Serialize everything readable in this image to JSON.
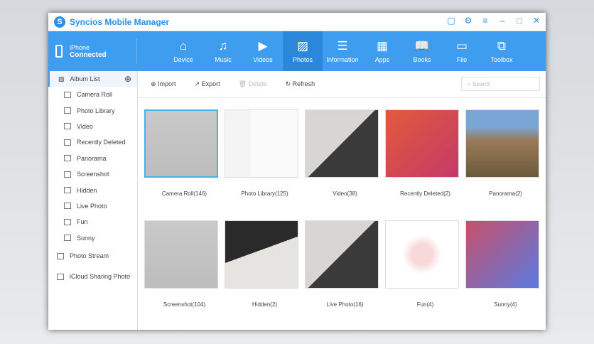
{
  "app": {
    "title": "Syncios Mobile Manager"
  },
  "device": {
    "name": "iPhone",
    "status": "Connected"
  },
  "tabs": [
    {
      "label": "Device",
      "icon": "⌂"
    },
    {
      "label": "Music",
      "icon": "♫"
    },
    {
      "label": "Videos",
      "icon": "▶"
    },
    {
      "label": "Photos",
      "icon": "▨"
    },
    {
      "label": "Information",
      "icon": "☰"
    },
    {
      "label": "Apps",
      "icon": "▦"
    },
    {
      "label": "Books",
      "icon": "📖"
    },
    {
      "label": "File",
      "icon": "▭"
    },
    {
      "label": "Toolbox",
      "icon": "⧉"
    }
  ],
  "sidebar": {
    "header": "Album List",
    "albums": [
      "Camera Roll",
      "Photo Library",
      "Video",
      "Recently Deleted",
      "Panorama",
      "Screenshot",
      "Hidden",
      "Live Photo",
      "Fun",
      "Sunny"
    ],
    "extra": [
      "Photo Stream",
      "iCloud Sharing Photo"
    ]
  },
  "toolbar": {
    "import": "Import",
    "export": "Export",
    "delete": "Delete",
    "refresh": "Refresh",
    "search_placeholder": "Search"
  },
  "grid": [
    {
      "label": "Camera Roll(146)",
      "bg": "linear-gradient(#c9c9c9,#bdbdbd)"
    },
    {
      "label": "Photo Library(125)",
      "bg": "linear-gradient(90deg,#f4f4f4 35%,#fafafa 35%)"
    },
    {
      "label": "Video(38)",
      "bg": "linear-gradient(135deg,#d8d6d2 50%,#3a3a3a 50%)"
    },
    {
      "label": "Recently Deleted(2)",
      "bg": "linear-gradient(135deg,#e25a3a,#c43a6a)"
    },
    {
      "label": "Panorama(2)",
      "bg": "linear-gradient(#7aa6d6 25%,#9a7a5a 45%,#6a5a3a)"
    },
    {
      "label": "Screenshot(104)",
      "bg": "linear-gradient(#c9c9c9,#bdbdbd)"
    },
    {
      "label": "Hidden(2)",
      "bg": "linear-gradient(160deg,#2a2a2a 45%,#e6e4e0 45%)"
    },
    {
      "label": "Live Photo(16)",
      "bg": "linear-gradient(135deg,#d8d6d2 50%,#3a3a3a 50%)"
    },
    {
      "label": "Fun(4)",
      "bg": "radial-gradient(circle,#f8d8d8 20%,#fff 40%)"
    },
    {
      "label": "Sunny(4)",
      "bg": "linear-gradient(135deg,#c8506a,#5a7ae0)"
    }
  ]
}
